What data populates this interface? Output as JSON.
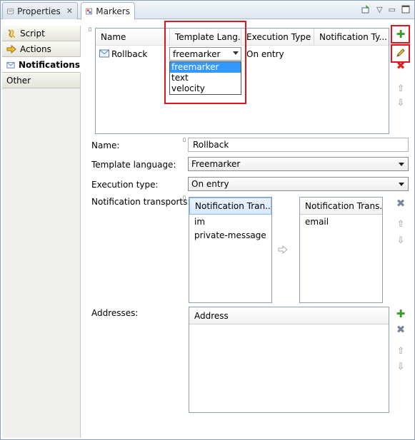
{
  "tabs": {
    "properties": "Properties",
    "markers": "Markers"
  },
  "nav": {
    "items": [
      {
        "label": "Script"
      },
      {
        "label": "Actions"
      },
      {
        "label": "Notifications"
      },
      {
        "label": "Other"
      }
    ]
  },
  "notifications_table": {
    "columns": [
      "Name",
      "Template Lang...",
      "Execution Type",
      "Notification Ty..."
    ],
    "rows": [
      {
        "name": "Rollback",
        "template_language": "freemarker",
        "execution_type": "On entry",
        "notification_type": ""
      }
    ],
    "template_dropdown": {
      "options": [
        "freemarker",
        "text",
        "velocity"
      ],
      "highlighted": "freemarker"
    }
  },
  "form": {
    "name_label": "Name:",
    "name_value": "Rollback",
    "template_label": "Template language:",
    "template_value": "Freemarker",
    "execution_label": "Execution type:",
    "execution_value": "On entry",
    "transports_label": "Notification transports:",
    "addresses_label": "Addresses:"
  },
  "transports": {
    "available_header": "Notification Tran...",
    "available_items": [
      "im",
      "private-message"
    ],
    "selected_header": "Notification Trans...",
    "selected_items": [
      "email"
    ]
  },
  "addresses": {
    "header": "Address"
  },
  "colors": {
    "highlight_box": "#e0141e",
    "selection_blue": "#3399ff",
    "add_green": "#3a9a2c"
  }
}
